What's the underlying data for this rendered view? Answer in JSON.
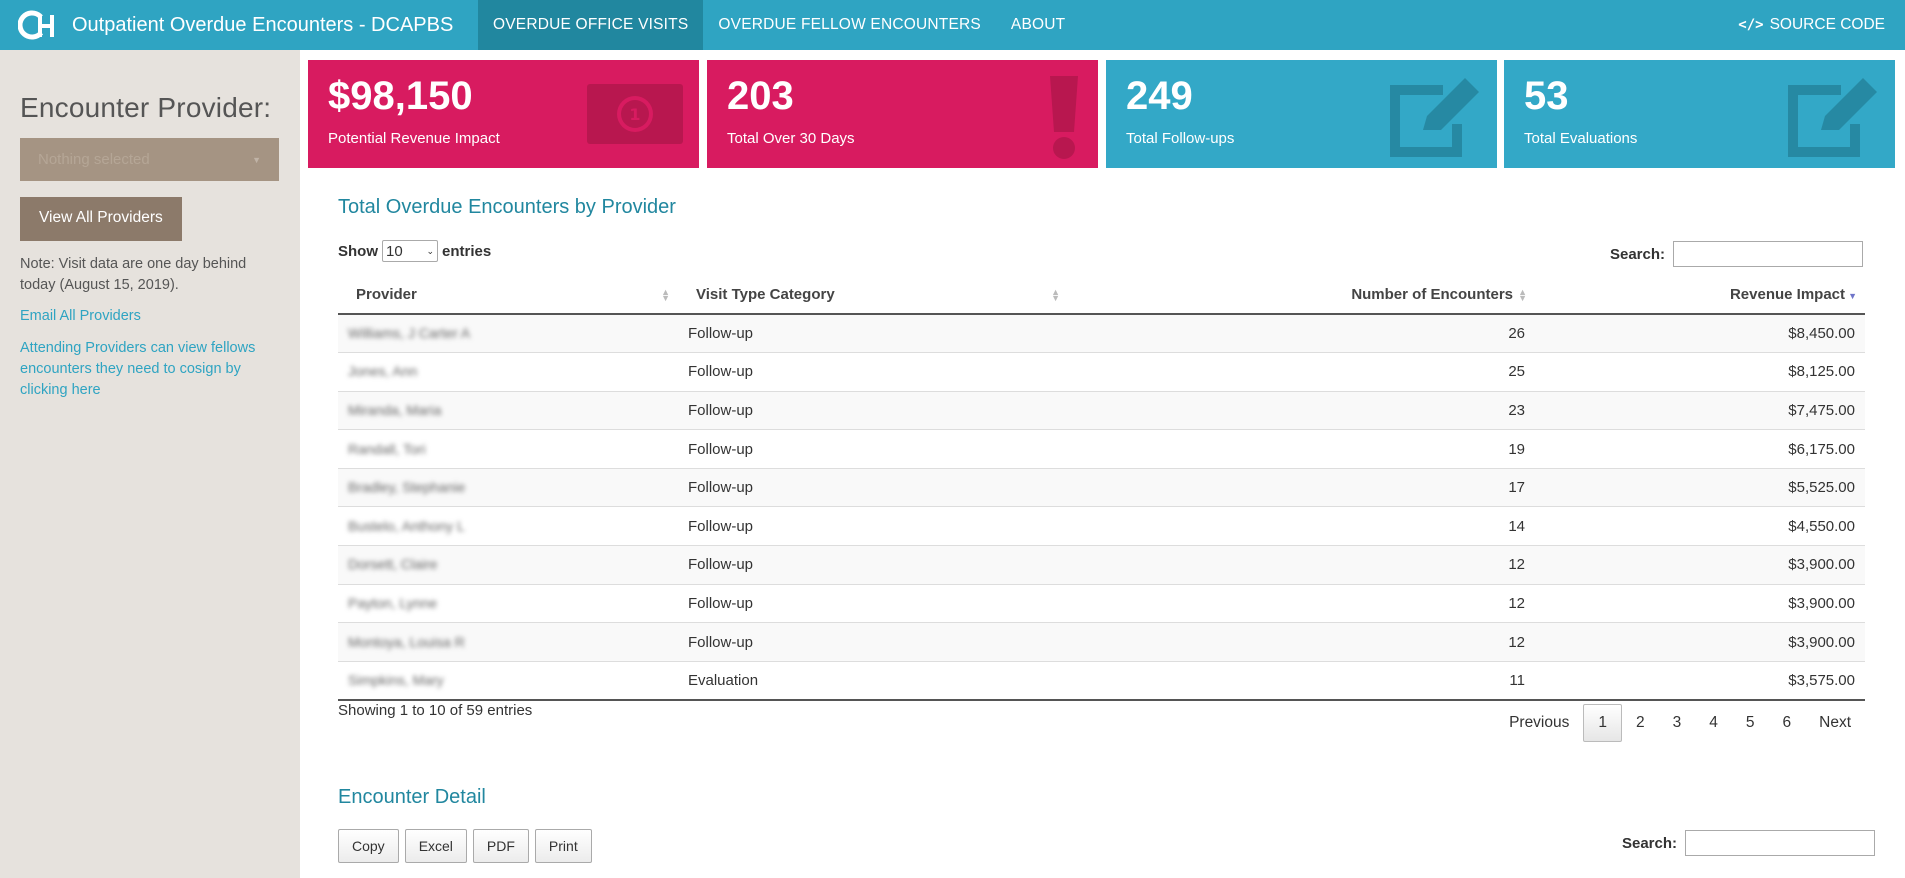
{
  "navbar": {
    "title": "Outpatient Overdue Encounters - DCAPBS",
    "logo_text": "CH",
    "items": [
      {
        "label": "OVERDUE OFFICE VISITS"
      },
      {
        "label": "OVERDUE FELLOW ENCOUNTERS"
      },
      {
        "label": "ABOUT"
      }
    ],
    "source_code": "SOURCE CODE"
  },
  "sidebar": {
    "heading": "Encounter Provider:",
    "select_placeholder": "Nothing selected",
    "view_all_button": "View All Providers",
    "note": "Note: Visit data are one day behind today (August 15, 2019).",
    "email_link": "Email All Providers",
    "attending_link": "Attending Providers can view fellows encounters they need to cosign by clicking here"
  },
  "cards": [
    {
      "value": "$98,150",
      "label": "Potential Revenue Impact",
      "icon": "money-icon",
      "color": "#d81b60"
    },
    {
      "value": "203",
      "label": "Total Over 30 Days",
      "icon": "exclamation-icon",
      "color": "#d81b60"
    },
    {
      "value": "249",
      "label": "Total Follow-ups",
      "icon": "edit-icon",
      "color": "#33a8c7"
    },
    {
      "value": "53",
      "label": "Total Evaluations",
      "icon": "edit-icon",
      "color": "#33a8c7"
    }
  ],
  "table_section": {
    "title": "Total Overdue Encounters by Provider",
    "show_label": "Show",
    "entries_value": "10",
    "entries_label": "entries",
    "search_label": "Search:",
    "columns": [
      "Provider",
      "Visit Type Category",
      "Number of Encounters",
      "Revenue Impact"
    ],
    "rows": [
      {
        "provider": "Williams, J Carter A",
        "type": "Follow-up",
        "count": "26",
        "revenue": "$8,450.00"
      },
      {
        "provider": "Jones, Ann",
        "type": "Follow-up",
        "count": "25",
        "revenue": "$8,125.00"
      },
      {
        "provider": "Miranda, Maria",
        "type": "Follow-up",
        "count": "23",
        "revenue": "$7,475.00"
      },
      {
        "provider": "Randall, Tori",
        "type": "Follow-up",
        "count": "19",
        "revenue": "$6,175.00"
      },
      {
        "provider": "Bradley, Stephanie",
        "type": "Follow-up",
        "count": "17",
        "revenue": "$5,525.00"
      },
      {
        "provider": "Bustelo, Anthony L",
        "type": "Follow-up",
        "count": "14",
        "revenue": "$4,550.00"
      },
      {
        "provider": "Dorsett, Claire",
        "type": "Follow-up",
        "count": "12",
        "revenue": "$3,900.00"
      },
      {
        "provider": "Payton, Lynne",
        "type": "Follow-up",
        "count": "12",
        "revenue": "$3,900.00"
      },
      {
        "provider": "Montoya, Louisa R",
        "type": "Follow-up",
        "count": "12",
        "revenue": "$3,900.00"
      },
      {
        "provider": "Simpkins, Mary",
        "type": "Evaluation",
        "count": "11",
        "revenue": "$3,575.00"
      }
    ],
    "showing": "Showing 1 to 10 of 59 entries",
    "pager": {
      "previous": "Previous",
      "pages": [
        "1",
        "2",
        "3",
        "4",
        "5",
        "6"
      ],
      "next": "Next"
    }
  },
  "detail_section": {
    "title": "Encounter Detail",
    "buttons": [
      "Copy",
      "Excel",
      "PDF",
      "Print"
    ],
    "search_label": "Search:"
  }
}
